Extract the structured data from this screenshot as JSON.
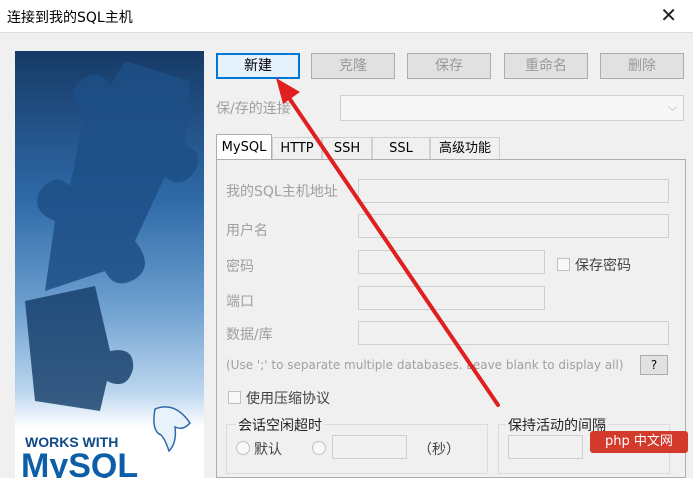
{
  "window": {
    "title": "连接到我的SQL主机"
  },
  "toolbar": {
    "new": "新建",
    "clone": "克隆",
    "save": "保存",
    "rename": "重命名",
    "delete": "删除"
  },
  "saved": {
    "label": "保/存的连接"
  },
  "tabs": [
    "MySQL",
    "HTTP",
    "SSH",
    "SSL",
    "高级功能"
  ],
  "form": {
    "host": "我的SQL主机地址",
    "user": "用户名",
    "password": "密码",
    "save_password": "保存密码",
    "port": "端口",
    "database": "数据/库",
    "database_hint": "(Use ';' to separate multiple databases. Leave blank to display all)",
    "help": "?",
    "compression": "使用压缩协议",
    "session_timeout": "会话空闲超时",
    "default": "默认",
    "seconds": "（秒）",
    "keepalive": "保持活动的间隔"
  },
  "banner": {
    "works_with": "WORKS WITH",
    "brand": "MySQL"
  },
  "watermark": {
    "text": "php 中文网"
  },
  "colors": {
    "accent": "#0078d7",
    "arrow": "#e02020",
    "watermark": "#d33a2c"
  }
}
